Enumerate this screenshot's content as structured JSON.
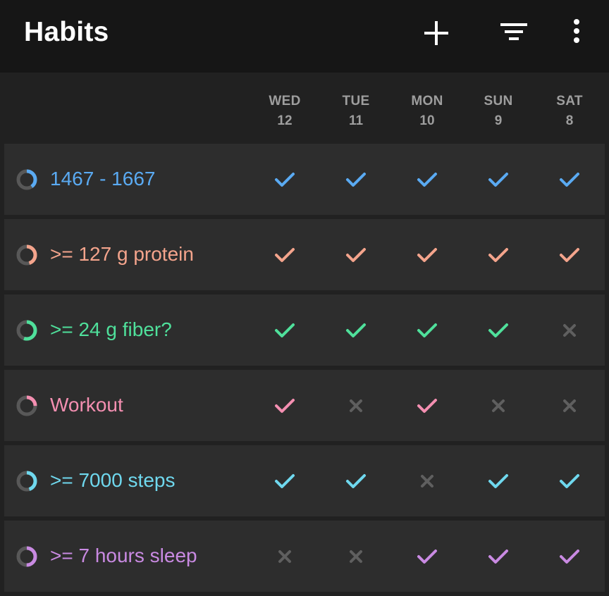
{
  "app": {
    "title": "Habits"
  },
  "toolbar": {
    "add_icon": "plus-icon",
    "filter_icon": "filter-icon",
    "more_icon": "more-vert-icon"
  },
  "colors": {
    "topbar_bg": "#161616",
    "page_bg": "#212121",
    "card_bg": "#2d2d2d",
    "missed": "#5f5f5f",
    "ring_track": "#585858"
  },
  "days": [
    {
      "dow": "WED",
      "date": "12"
    },
    {
      "dow": "TUE",
      "date": "11"
    },
    {
      "dow": "MON",
      "date": "10"
    },
    {
      "dow": "SUN",
      "date": "9"
    },
    {
      "dow": "SAT",
      "date": "8"
    }
  ],
  "habits": [
    {
      "name": "1467 - 1667",
      "color": "#5aaaf2",
      "score": 0.4,
      "checks": [
        true,
        true,
        true,
        true,
        true
      ]
    },
    {
      "name": ">= 127 g protein",
      "color": "#f4a48c",
      "score": 0.45,
      "checks": [
        true,
        true,
        true,
        true,
        true
      ]
    },
    {
      "name": ">= 24 g fiber?",
      "color": "#4fe09b",
      "score": 0.55,
      "checks": [
        true,
        true,
        true,
        true,
        false
      ]
    },
    {
      "name": "Workout",
      "color": "#f48fb1",
      "score": 0.25,
      "checks": [
        true,
        false,
        true,
        false,
        false
      ]
    },
    {
      "name": ">= 7000 steps",
      "color": "#6fd8ee",
      "score": 0.45,
      "checks": [
        true,
        true,
        false,
        true,
        true
      ]
    },
    {
      "name": ">= 7 hours sleep",
      "color": "#c98ae2",
      "score": 0.5,
      "checks": [
        false,
        false,
        true,
        true,
        true
      ]
    }
  ]
}
